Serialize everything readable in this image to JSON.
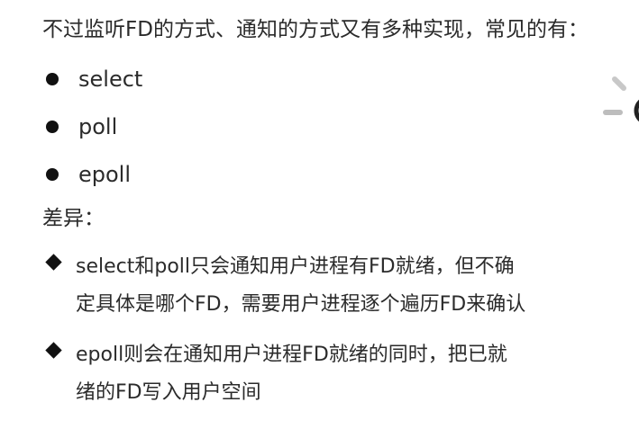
{
  "intro": "不过监听FD的方式、通知的方式又有多种实现，常见的有：",
  "methods": [
    "select",
    "poll",
    "epoll"
  ],
  "diff_title": "差异：",
  "differences": [
    {
      "line1": "select和poll只会通知用户进程有FD就绪，但不确",
      "line2": "定具体是哪个FD，需要用户进程逐个遍历FD来确认"
    },
    {
      "line1": "epoll则会在通知用户进程FD就绪的同时，把已就",
      "line2": "绪的FD写入用户空间"
    }
  ]
}
